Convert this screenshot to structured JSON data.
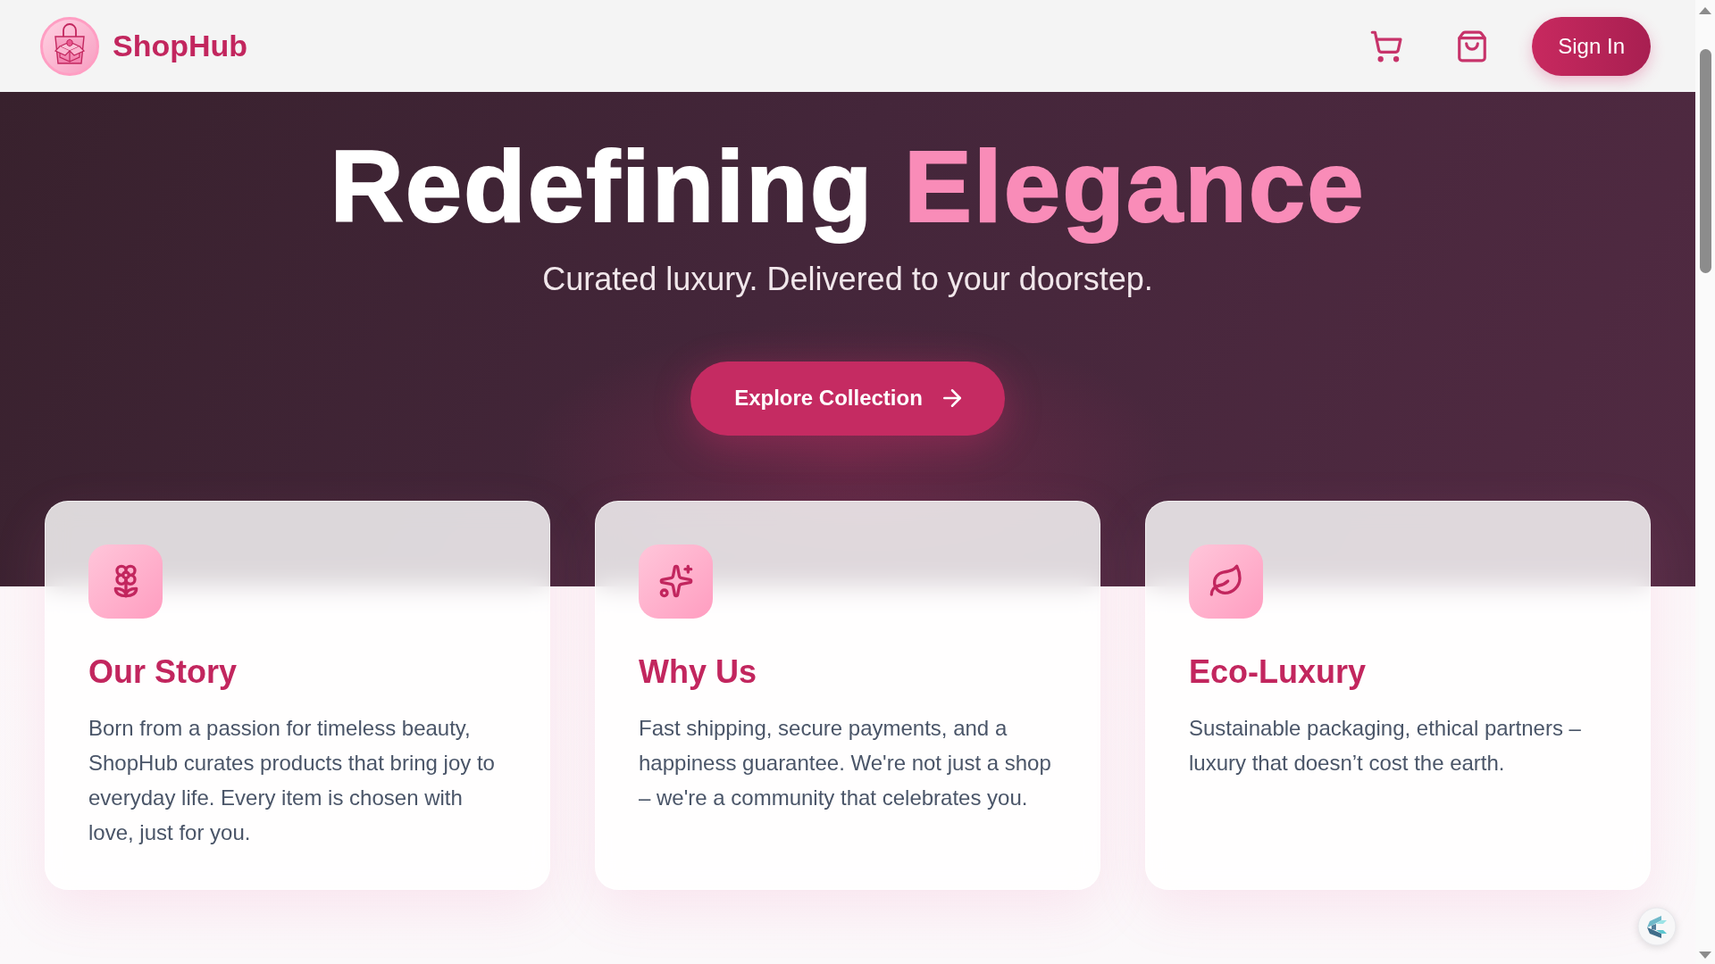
{
  "header": {
    "brand": "ShopHub",
    "sign_in": "Sign In"
  },
  "hero": {
    "title": "Redefining **Elegance**",
    "subtitle": "Curated luxury. Delivered to your doorstep.",
    "cta": "Explore Collection"
  },
  "features": [
    {
      "kind": "flower",
      "title": "Our Story",
      "text": "Born from a passion for timeless beauty, ShopHub curates products that bring joy to everyday life. Every item is chosen with love, just for you."
    },
    {
      "kind": "sparkles",
      "title": "Why Us",
      "text": "Fast shipping, secure payments, and a happiness guarantee. We're not just a shop – we're a community that celebrates you."
    },
    {
      "kind": "leaf",
      "title": "Eco-Luxury",
      "text": "Sustainable packaging, ethical partners – luxury that doesn’t cost the earth."
    }
  ]
}
